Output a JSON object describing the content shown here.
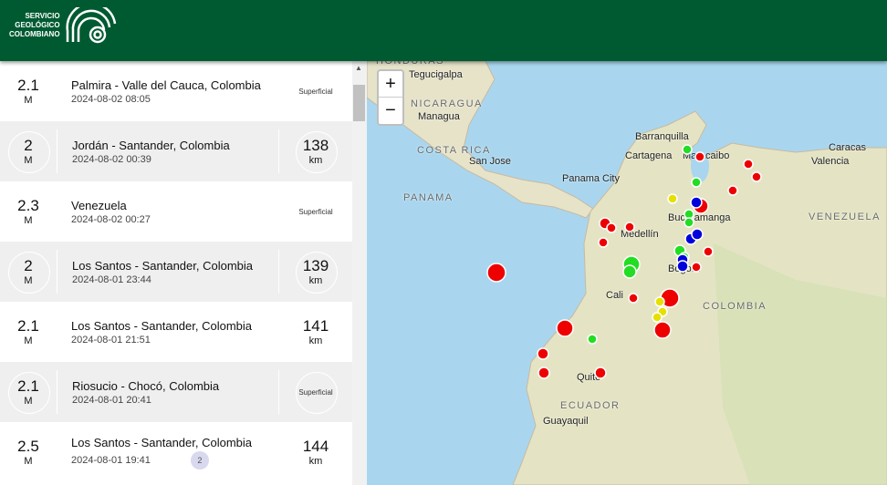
{
  "header": {
    "logo_lines": [
      "SERVICIO",
      "GEOLÓGICO",
      "COLOMBIANO"
    ],
    "brand_color": "#005a31"
  },
  "events": [
    {
      "magnitude": "2.1",
      "mag_unit": "M",
      "place": "Palmira - Valle del Cauca, Colombia",
      "time": "2024-08-02 08:05",
      "depth": "Superficial",
      "depth_unit": ""
    },
    {
      "magnitude": "2",
      "mag_unit": "M",
      "place": "Jordán - Santander, Colombia",
      "time": "2024-08-02 00:39",
      "depth": "138",
      "depth_unit": "km"
    },
    {
      "magnitude": "2.3",
      "mag_unit": "M",
      "place": "Venezuela",
      "time": "2024-08-02 00:27",
      "depth": "Superficial",
      "depth_unit": ""
    },
    {
      "magnitude": "2",
      "mag_unit": "M",
      "place": "Los Santos - Santander, Colombia",
      "time": "2024-08-01 23:44",
      "depth": "139",
      "depth_unit": "km"
    },
    {
      "magnitude": "2.1",
      "mag_unit": "M",
      "place": "Los Santos - Santander, Colombia",
      "time": "2024-08-01 21:51",
      "depth": "141",
      "depth_unit": "km"
    },
    {
      "magnitude": "2.1",
      "mag_unit": "M",
      "place": "Riosucio - Chocó, Colombia",
      "time": "2024-08-01 20:41",
      "depth": "Superficial",
      "depth_unit": ""
    },
    {
      "magnitude": "2.5",
      "mag_unit": "M",
      "place": "Los Santos - Santander, Colombia",
      "time": "2024-08-01 19:41",
      "depth": "144",
      "depth_unit": "km",
      "badge": "2"
    }
  ],
  "map": {
    "zoom_in": "+",
    "zoom_out": "−",
    "countries": [
      "HONDURAS",
      "NICARAGUA",
      "COSTA RICA",
      "PANAMA",
      "COLOMBIA",
      "VENEZUELA",
      "ECUADOR"
    ],
    "cities": [
      "Tegucigalpa",
      "Managua",
      "San Jose",
      "Panama City",
      "Barranquilla",
      "Cartagena",
      "Maracaibo",
      "Caracas",
      "Valencia",
      "Bucaramanga",
      "Medellín",
      "Bogota",
      "Cali",
      "Quito",
      "Guayaquil"
    ],
    "marker_colors": {
      "red": "#ee0000",
      "green": "#22dd22",
      "yellow": "#e6e000",
      "blue": "#0000dd"
    }
  }
}
